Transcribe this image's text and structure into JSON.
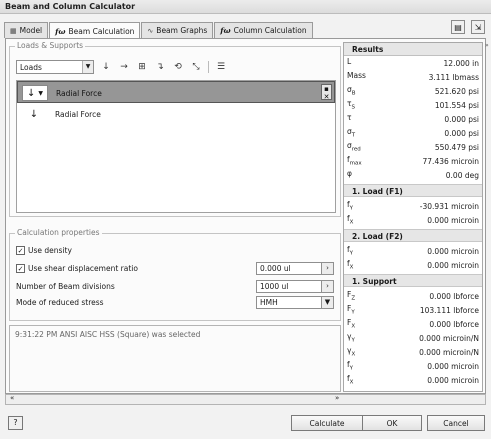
{
  "window": {
    "title": "Beam and Column Calculator"
  },
  "tabs": [
    {
      "label": "Model"
    },
    {
      "label": "Beam Calculation"
    },
    {
      "label": "Beam Graphs"
    },
    {
      "label": "Column Calculation"
    }
  ],
  "loads_supports": {
    "legend": "Loads & Supports",
    "combo_value": "Loads",
    "items": [
      {
        "label": "Radial Force",
        "selected": true
      },
      {
        "label": "Radial Force",
        "selected": false
      }
    ]
  },
  "calc": {
    "legend": "Calculation properties",
    "use_density": {
      "label": "Use density",
      "checked": true
    },
    "use_shear": {
      "label": "Use shear displacement ratio",
      "checked": true,
      "value": "0.000 ul"
    },
    "beam_divisions": {
      "label": "Number of Beam divisions",
      "value": "1000 ul"
    },
    "reduced_stress": {
      "label": "Mode of reduced stress",
      "value": "HMH"
    }
  },
  "log": {
    "message": "9:31:22 PM ANSI AISC HSS (Square) was selected"
  },
  "results": {
    "title": "Results",
    "main": [
      {
        "sym": "L",
        "sub": "",
        "value": "12.000 in"
      },
      {
        "sym": "Mass",
        "sub": "",
        "value": "3.111 lbmass"
      },
      {
        "sym": "σ",
        "sub": "B",
        "value": "521.620 psi"
      },
      {
        "sym": "τ",
        "sub": "S",
        "value": "101.554 psi"
      },
      {
        "sym": "τ",
        "sub": "",
        "value": "0.000 psi"
      },
      {
        "sym": "σ",
        "sub": "T",
        "value": "0.000 psi"
      },
      {
        "sym": "σ",
        "sub": "red",
        "value": "550.479 psi"
      },
      {
        "sym": "f",
        "sub": "max",
        "value": "77.436 microin"
      },
      {
        "sym": "φ",
        "sub": "",
        "value": "0.00 deg"
      }
    ],
    "load1": {
      "title": "1. Load (F1)",
      "rows": [
        {
          "sym": "f",
          "sub": "Y",
          "value": "-30.931 microin"
        },
        {
          "sym": "f",
          "sub": "X",
          "value": "0.000 microin"
        }
      ]
    },
    "load2": {
      "title": "2. Load (F2)",
      "rows": [
        {
          "sym": "f",
          "sub": "Y",
          "value": "0.000 microin"
        },
        {
          "sym": "f",
          "sub": "X",
          "value": "0.000 microin"
        }
      ]
    },
    "support1": {
      "title": "1. Support",
      "rows": [
        {
          "sym": "F",
          "sub": "Z",
          "value": "0.000 lbforce"
        },
        {
          "sym": "F",
          "sub": "Y",
          "value": "103.111 lbforce"
        },
        {
          "sym": "F",
          "sub": "X",
          "value": "0.000 lbforce"
        },
        {
          "sym": "γ",
          "sub": "Y",
          "value": "0.000 microin/N"
        },
        {
          "sym": "γ",
          "sub": "X",
          "value": "0.000 microin/N"
        },
        {
          "sym": "f",
          "sub": "Y",
          "value": "0.000 microin"
        },
        {
          "sym": "f",
          "sub": "X",
          "value": "0.000 microin"
        }
      ]
    }
  },
  "buttons": {
    "calculate": "Calculate",
    "ok": "OK",
    "cancel": "Cancel",
    "help": "?"
  }
}
